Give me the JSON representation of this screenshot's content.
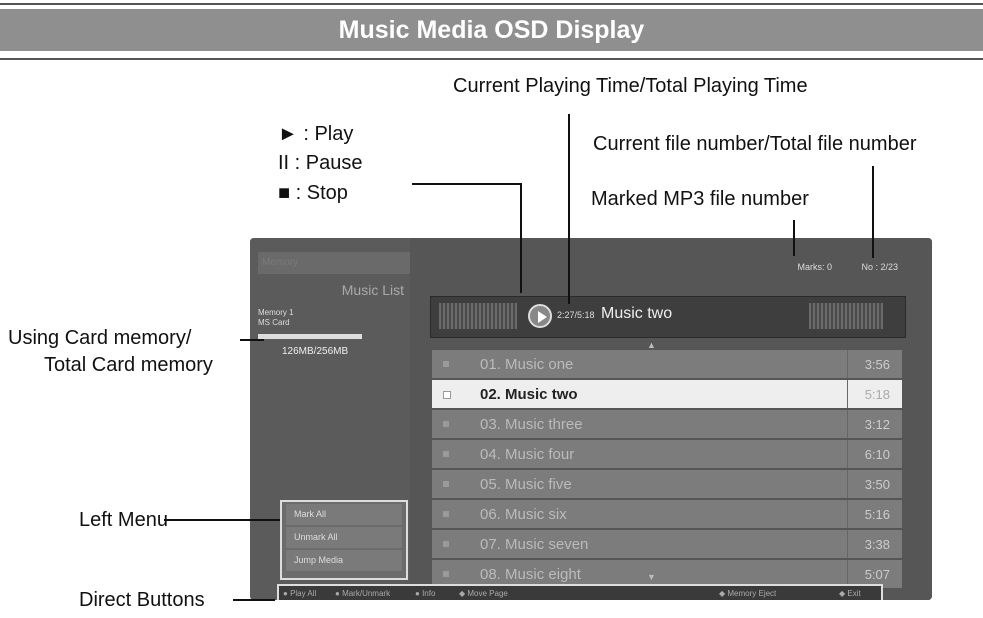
{
  "header": {
    "title": "Music Media OSD Display"
  },
  "callouts": {
    "current_playing_time": "Current Playing Time/Total Playing Time",
    "play": "► : Play",
    "pause": "II  : Pause",
    "stop": "■ : Stop",
    "file_number": "Current file number/Total file number",
    "marked": "Marked MP3 file number",
    "card_memory_1": "Using Card memory/",
    "card_memory_2": "Total Card memory",
    "left_menu": "Left Menu",
    "direct_buttons": "Direct Buttons"
  },
  "screen": {
    "top_tab": "Memory",
    "music_list": "Music List",
    "memory_label_1": "Memory 1",
    "memory_label_2": "MS Card",
    "memory_usage": "126MB/256MB",
    "marks": "Marks: 0",
    "file_no": "No : 2/23",
    "now_time": "2:27/5:18",
    "now_title": "Music two",
    "left_menu": [
      "Mark All",
      "Unmark All",
      "Jump Media"
    ],
    "tracks": [
      {
        "name": "01. Music one",
        "time": "3:56"
      },
      {
        "name": "02. Music two",
        "time": "5:18"
      },
      {
        "name": "03. Music three",
        "time": "3:12"
      },
      {
        "name": "04. Music four",
        "time": "6:10"
      },
      {
        "name": "05. Music five",
        "time": "3:50"
      },
      {
        "name": "06. Music six",
        "time": "5:16"
      },
      {
        "name": "07. Music seven",
        "time": "3:38"
      },
      {
        "name": "08. Music eight",
        "time": "5:07"
      }
    ],
    "footer": {
      "play_all": "Play All",
      "mark_unmark": "Mark/Unmark",
      "info": "Info",
      "move_page": "Move Page",
      "memory_eject": "Memory Eject",
      "exit": "Exit"
    }
  }
}
